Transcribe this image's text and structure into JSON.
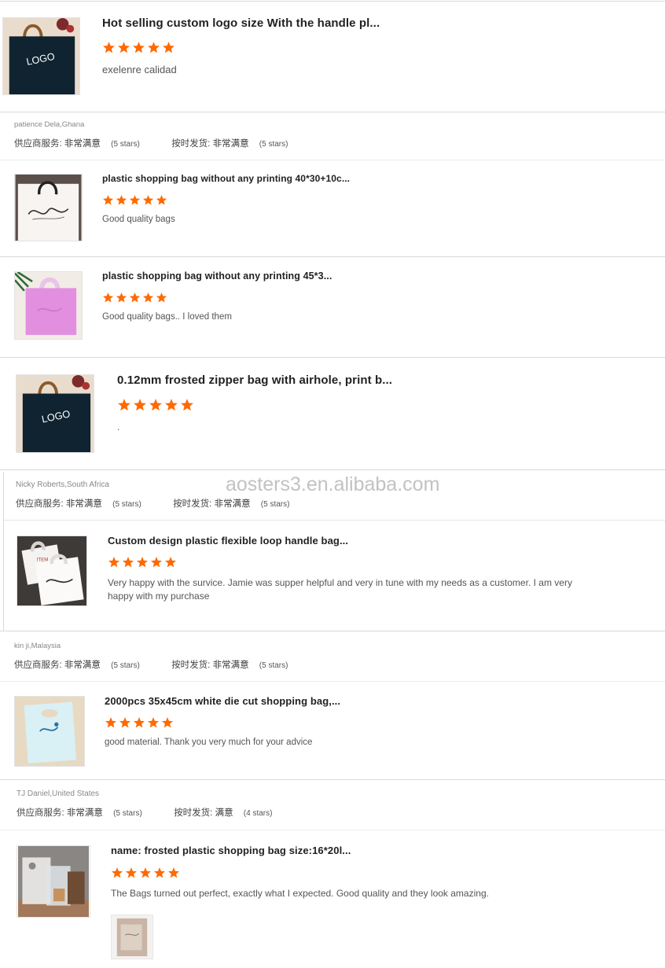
{
  "reviews": [
    {
      "title": "Hot selling custom logo size With the handle pl...",
      "rating": 5,
      "text": "exelenre calidad",
      "thumb": "navy-logo-bag-icon"
    },
    {
      "title": "plastic shopping bag without any printing 40*30+10c...",
      "rating": 5,
      "text": "Good quality bags",
      "thumb": "white-script-bag-icon"
    },
    {
      "title": "plastic shopping bag without any printing 45*3...",
      "rating": 5,
      "text": "Good quality bags.. I loved them",
      "thumb": "pink-bag-icon"
    },
    {
      "title": "0.12mm frosted zipper bag with airhole, print b...",
      "rating": 5,
      "text": ".",
      "thumb": "navy-logo-bag-icon"
    },
    {
      "title": "Custom design plastic flexible loop handle bag...",
      "rating": 5,
      "text": "Very happy with the survice.  Jamie was supper helpful and very in tune with my needs as a customer.  I am very happy with my purchase",
      "thumb": "loop-handle-bags-icon"
    },
    {
      "title": "2000pcs 35x45cm white die cut shopping bag,...",
      "rating": 5,
      "text": "good material. Thank you very much for your advice",
      "thumb": "blue-die-cut-bag-icon"
    },
    {
      "title": "name: frosted plastic shopping bag size:16*20l...",
      "rating": 5,
      "text": "The Bags turned out perfect, exactly what I expected. Good quality and they look amazing.",
      "thumb": "frosted-bags-icon"
    }
  ],
  "thumb_logo_text": "LOGO",
  "buyers": [
    {
      "name": "patience Dela,Ghana",
      "service_label": "供应商服务:",
      "service_value": "非常满意",
      "service_count": "(5 stars)",
      "ship_label": "按时发货:",
      "ship_value": "非常满意",
      "ship_count": "(5 stars)"
    },
    {
      "name": "Nicky Roberts,South Africa",
      "service_label": "供应商服务:",
      "service_value": "非常满意",
      "service_count": "(5 stars)",
      "ship_label": "按时发货:",
      "ship_value": "非常满意",
      "ship_count": "(5 stars)"
    },
    {
      "name": "kin ji,Malaysia",
      "service_label": "供应商服务:",
      "service_value": "非常满意",
      "service_count": "(5 stars)",
      "ship_label": "按时发货:",
      "ship_value": "非常满意",
      "ship_count": "(5 stars)"
    },
    {
      "name": "TJ Daniel,United States",
      "service_label": "供应商服务:",
      "service_value": "非常满意",
      "service_count": "(5 stars)",
      "ship_label": "按时发货:",
      "ship_value": "满意",
      "ship_count": "(4 stars)"
    }
  ],
  "watermark": "aosters3.en.alibaba.com",
  "colors": {
    "star": "#ff6a00",
    "divider": "#d9d9d9",
    "navy_bag": "#0f2330",
    "pink_bag": "#e38fe0"
  }
}
